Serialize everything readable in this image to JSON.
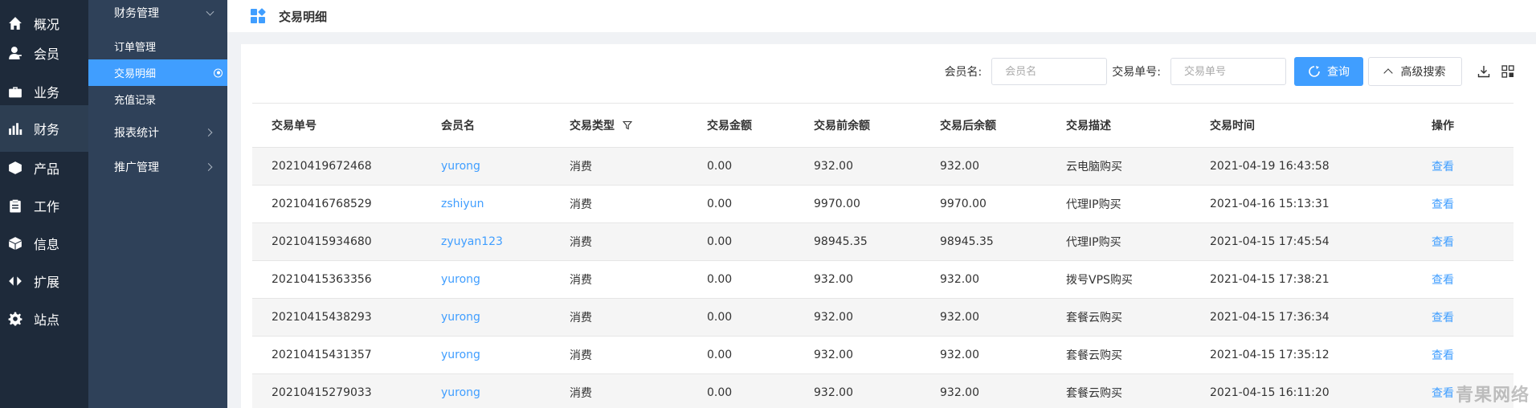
{
  "rail": [
    {
      "label": "概况",
      "icon": "home-icon"
    },
    {
      "label": "会员",
      "icon": "user-icon"
    },
    {
      "label": "业务",
      "icon": "briefcase-icon"
    },
    {
      "label": "财务",
      "icon": "finance-chart-icon",
      "active": true
    },
    {
      "label": "产品",
      "icon": "cube-icon"
    },
    {
      "label": "工作",
      "icon": "clipboard-icon"
    },
    {
      "label": "信息",
      "icon": "box-icon"
    },
    {
      "label": "扩展",
      "icon": "code-icon"
    },
    {
      "label": "站点",
      "icon": "gear-icon"
    }
  ],
  "submenu": {
    "group_title": "财务管理",
    "items": [
      {
        "label": "订单管理"
      },
      {
        "label": "交易明细",
        "active": true
      },
      {
        "label": "充值记录"
      }
    ],
    "groups": [
      {
        "label": "报表统计"
      },
      {
        "label": "推广管理"
      }
    ]
  },
  "header": {
    "title": "交易明细",
    "icon": "dashboard-grid-icon"
  },
  "search": {
    "member_label": "会员名:",
    "member_placeholder": "会员名",
    "txn_label": "交易单号:",
    "txn_placeholder": "交易单号",
    "query_label": "查询",
    "advanced_label": "高级搜索",
    "tool_icons": [
      "download-icon",
      "grid-view-icon"
    ]
  },
  "table": {
    "columns": [
      "交易单号",
      "会员名",
      "交易类型",
      "交易金额",
      "交易前余额",
      "交易后余额",
      "交易描述",
      "交易时间",
      "操作"
    ],
    "rows": [
      {
        "id": "20210419672468",
        "member": "yurong",
        "type": "消费",
        "amount": "0.00",
        "before": "932.00",
        "after": "932.00",
        "desc": "云电脑购买",
        "time": "2021-04-19 16:43:58",
        "action": "查看"
      },
      {
        "id": "20210416768529",
        "member": "zshiyun",
        "type": "消费",
        "amount": "0.00",
        "before": "9970.00",
        "after": "9970.00",
        "desc": "代理IP购买",
        "time": "2021-04-16 15:13:31",
        "action": "查看"
      },
      {
        "id": "20210415934680",
        "member": "zyuyan123",
        "type": "消费",
        "amount": "0.00",
        "before": "98945.35",
        "after": "98945.35",
        "desc": "代理IP购买",
        "time": "2021-04-15 17:45:54",
        "action": "查看"
      },
      {
        "id": "20210415363356",
        "member": "yurong",
        "type": "消费",
        "amount": "0.00",
        "before": "932.00",
        "after": "932.00",
        "desc": "拨号VPS购买",
        "time": "2021-04-15 17:38:21",
        "action": "查看"
      },
      {
        "id": "20210415438293",
        "member": "yurong",
        "type": "消费",
        "amount": "0.00",
        "before": "932.00",
        "after": "932.00",
        "desc": "套餐云购买",
        "time": "2021-04-15 17:36:34",
        "action": "查看"
      },
      {
        "id": "20210415431357",
        "member": "yurong",
        "type": "消费",
        "amount": "0.00",
        "before": "932.00",
        "after": "932.00",
        "desc": "套餐云购买",
        "time": "2021-04-15 17:35:12",
        "action": "查看"
      },
      {
        "id": "20210415279033",
        "member": "yurong",
        "type": "消费",
        "amount": "0.00",
        "before": "932.00",
        "after": "932.00",
        "desc": "套餐云购买",
        "time": "2021-04-15 16:11:20",
        "action": "查看"
      }
    ]
  },
  "watermark": "青果网络",
  "colors": {
    "accent": "#409eff",
    "rail_bg": "#1e2a3a",
    "submenu_bg": "#2f4159"
  }
}
